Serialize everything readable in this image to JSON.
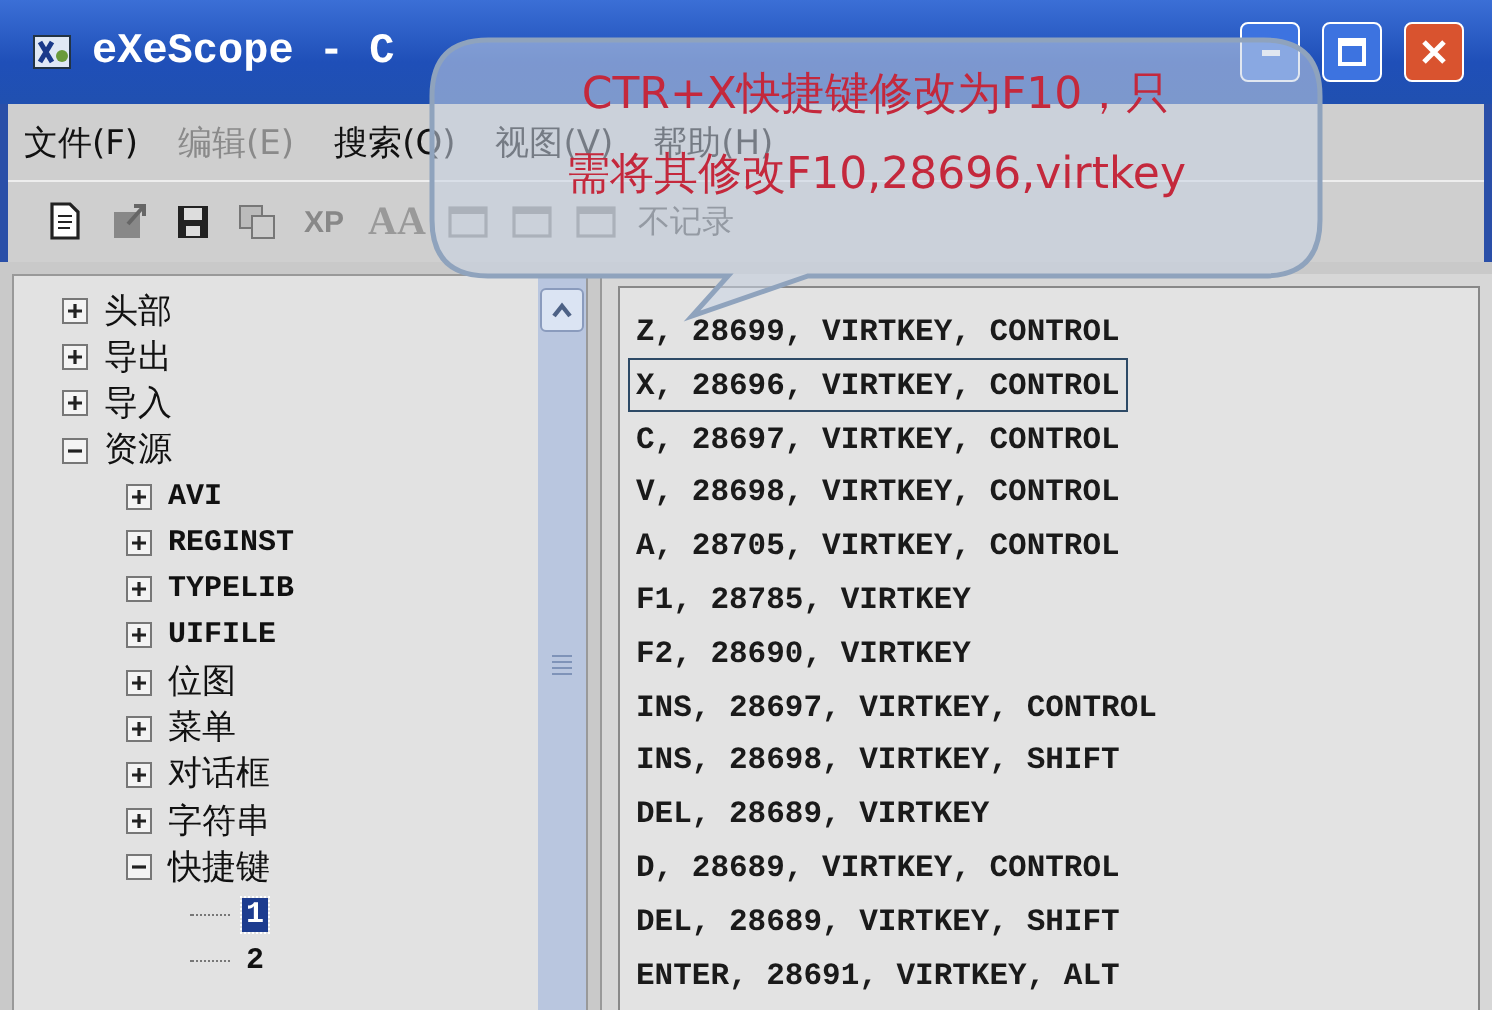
{
  "window": {
    "title": "eXeScope - C"
  },
  "menu": [
    {
      "label": "文件(F)",
      "disabled": false
    },
    {
      "label": "编辑(E)",
      "disabled": true
    },
    {
      "label": "搜索(Q)",
      "disabled": false
    },
    {
      "label": "视图(V)",
      "disabled": false
    },
    {
      "label": "帮助(H)",
      "disabled": false
    }
  ],
  "toolbar": [
    {
      "kind": "icon"
    },
    {
      "kind": "icon"
    },
    {
      "kind": "icon"
    },
    {
      "kind": "icon"
    },
    {
      "kind": "text",
      "label": "XP"
    },
    {
      "kind": "text",
      "label": "AA"
    },
    {
      "kind": "icon"
    },
    {
      "kind": "icon"
    },
    {
      "kind": "icon"
    },
    {
      "kind": "text",
      "label": "不记录"
    }
  ],
  "tree": [
    {
      "label": "头部",
      "expanded": false,
      "selected": false
    },
    {
      "label": "导出",
      "expanded": false,
      "selected": false
    },
    {
      "label": "导入",
      "expanded": false,
      "selected": false
    },
    {
      "label": "资源",
      "expanded": true,
      "selected": false,
      "children": [
        {
          "label": "AVI",
          "expanded": false,
          "selected": false
        },
        {
          "label": "REGINST",
          "expanded": false,
          "selected": false
        },
        {
          "label": "TYPELIB",
          "expanded": false,
          "selected": false
        },
        {
          "label": "UIFILE",
          "expanded": false,
          "selected": false
        },
        {
          "label": "位图",
          "expanded": false,
          "selected": false
        },
        {
          "label": "菜单",
          "expanded": false,
          "selected": false
        },
        {
          "label": "对话框",
          "expanded": false,
          "selected": false
        },
        {
          "label": "字符串",
          "expanded": false,
          "selected": false
        },
        {
          "label": "快捷键",
          "expanded": true,
          "selected": false,
          "children": [
            {
              "label": "1",
              "selected": true
            },
            {
              "label": "2",
              "selected": false
            }
          ]
        }
      ]
    }
  ],
  "accelerators": [
    {
      "text": "Z, 28699, VIRTKEY, CONTROL",
      "outlined": false
    },
    {
      "text": "X, 28696, VIRTKEY, CONTROL",
      "outlined": true
    },
    {
      "text": "C, 28697, VIRTKEY, CONTROL",
      "outlined": false
    },
    {
      "text": "V, 28698, VIRTKEY, CONTROL",
      "outlined": false
    },
    {
      "text": "A, 28705, VIRTKEY, CONTROL",
      "outlined": false
    },
    {
      "text": "F1, 28785, VIRTKEY",
      "outlined": false
    },
    {
      "text": "F2, 28690, VIRTKEY",
      "outlined": false
    },
    {
      "text": "INS, 28697, VIRTKEY, CONTROL",
      "outlined": false
    },
    {
      "text": "INS, 28698, VIRTKEY, SHIFT",
      "outlined": false
    },
    {
      "text": "DEL, 28689, VIRTKEY",
      "outlined": false
    },
    {
      "text": "D, 28689, VIRTKEY, CONTROL",
      "outlined": false
    },
    {
      "text": "DEL, 28689, VIRTKEY, SHIFT",
      "outlined": false
    },
    {
      "text": "ENTER, 28691, VIRTKEY, ALT",
      "outlined": false
    }
  ],
  "callout": {
    "lines": [
      "CTR+X快捷键修改为F10，只",
      "需将其修改F10,28696,virtkey"
    ]
  }
}
